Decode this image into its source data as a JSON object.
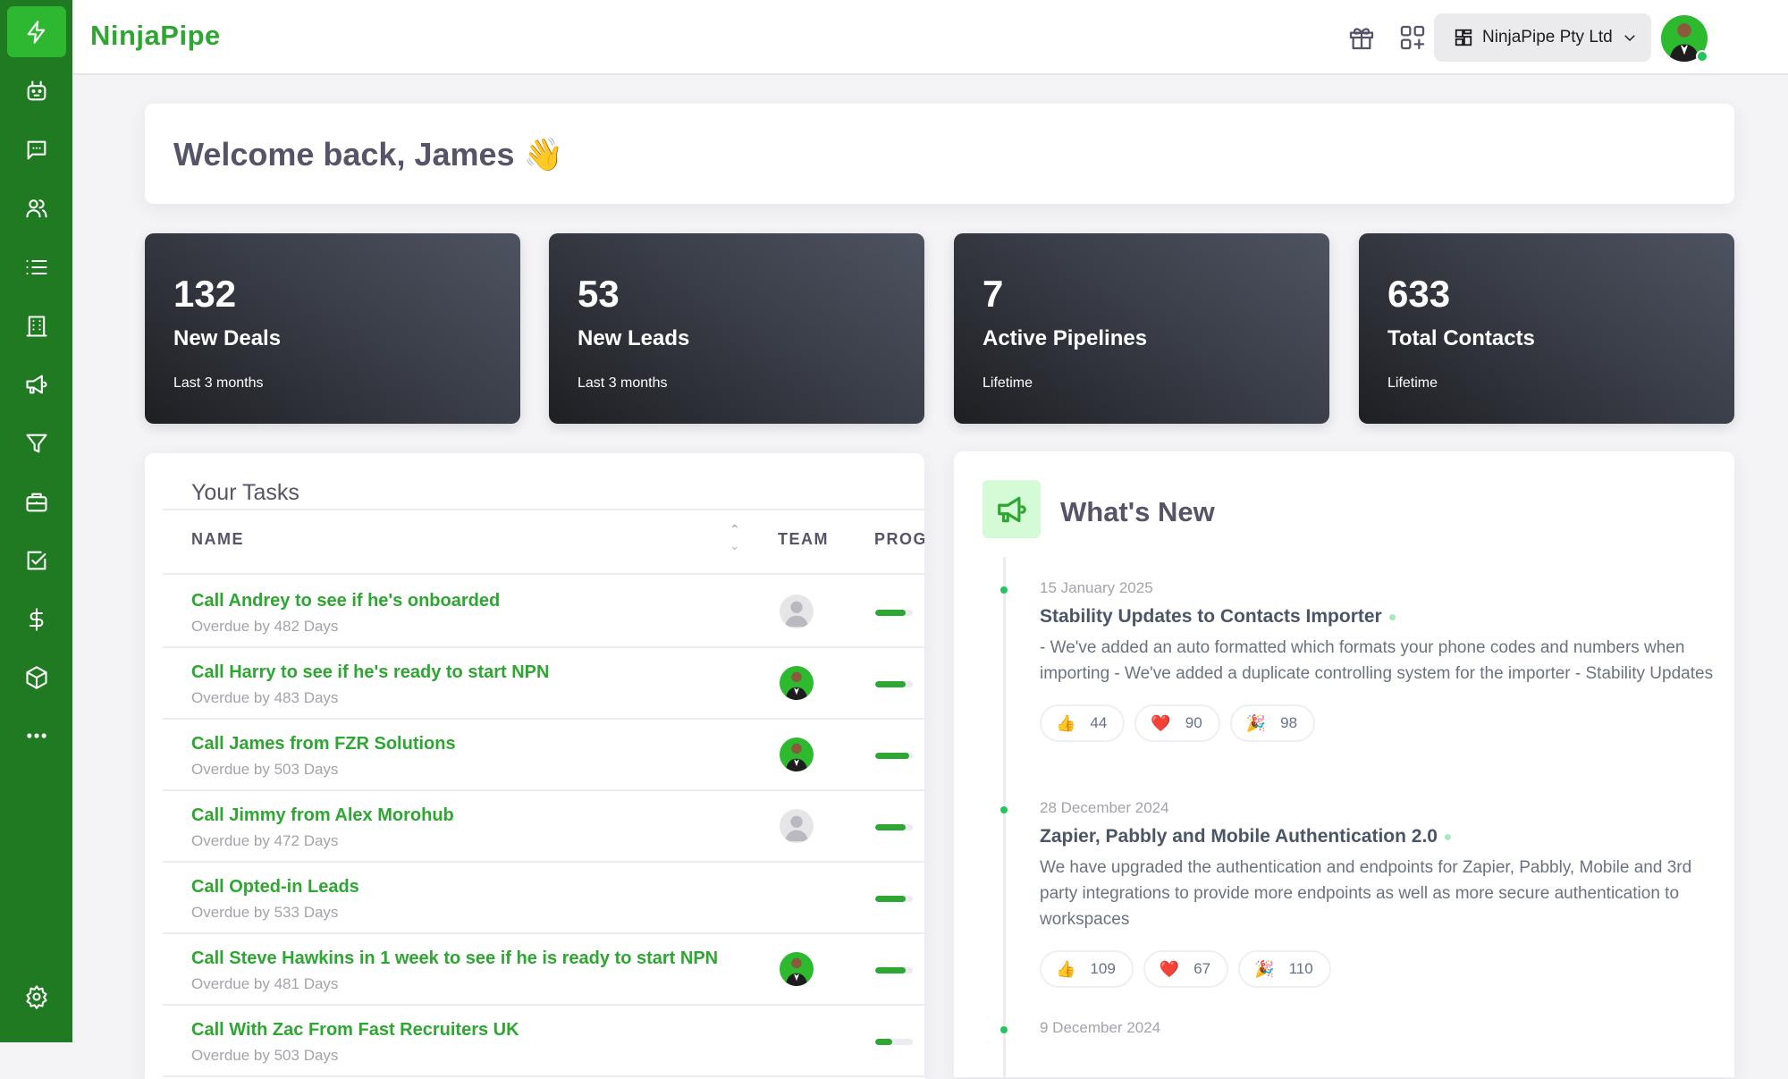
{
  "app": {
    "logo": "NinjaPipe"
  },
  "sidebar": {
    "items": [
      {
        "name": "dashboard",
        "icon": "lightning-icon",
        "active": true
      },
      {
        "name": "ai-bot",
        "icon": "robot-icon"
      },
      {
        "name": "conversations",
        "icon": "chat-icon"
      },
      {
        "name": "contacts",
        "icon": "users-icon"
      },
      {
        "name": "lists",
        "icon": "list-icon"
      },
      {
        "name": "companies",
        "icon": "building-icon"
      },
      {
        "name": "campaigns",
        "icon": "megaphone-icon"
      },
      {
        "name": "pipelines",
        "icon": "funnel-icon"
      },
      {
        "name": "deals",
        "icon": "briefcase-icon"
      },
      {
        "name": "tasks",
        "icon": "checkbox-icon"
      },
      {
        "name": "invoices",
        "icon": "dollar-icon"
      },
      {
        "name": "products",
        "icon": "cube-icon"
      },
      {
        "name": "more",
        "icon": "ellipsis-icon"
      },
      {
        "name": "settings",
        "icon": "gear-icon"
      }
    ]
  },
  "topbar": {
    "workspace_label": "NinjaPipe Pty Ltd",
    "icons": [
      "gift-icon",
      "add-app-icon",
      "bell-icon"
    ],
    "online_color": "#22c55e"
  },
  "welcome": {
    "text": "Welcome back, James",
    "emoji": "👋"
  },
  "stats": [
    {
      "value": "132",
      "label": "New Deals",
      "period": "Last 3 months"
    },
    {
      "value": "53",
      "label": "New Leads",
      "period": "Last 3 months"
    },
    {
      "value": "7",
      "label": "Active Pipelines",
      "period": "Lifetime"
    },
    {
      "value": "633",
      "label": "Total Contacts",
      "period": "Lifetime"
    }
  ],
  "tasks": {
    "title": "Your Tasks",
    "columns": {
      "name": "NAME",
      "team": "TEAM",
      "progress": "PROG"
    },
    "rows": [
      {
        "title": "Call Andrey to see if he's onboarded",
        "overdue": "Overdue by 482 Days",
        "team": "placeholder",
        "progress": 0.8
      },
      {
        "title": "Call Harry to see if he's ready to start NPN",
        "overdue": "Overdue by 483 Days",
        "team": "photo",
        "progress": 0.8
      },
      {
        "title": "Call James from FZR Solutions",
        "overdue": "Overdue by 503 Days",
        "team": "photo",
        "progress": 0.9
      },
      {
        "title": "Call Jimmy from Alex Morohub",
        "overdue": "Overdue by 472 Days",
        "team": "placeholder",
        "progress": 0.8
      },
      {
        "title": "Call Opted-in Leads",
        "overdue": "Overdue by 533 Days",
        "team": "none",
        "progress": 0.8
      },
      {
        "title": "Call Steve Hawkins in 1 week to see if he is ready to start NPN",
        "overdue": "Overdue by 481 Days",
        "team": "photo",
        "progress": 0.8
      },
      {
        "title": "Call With Zac From Fast Recruiters UK",
        "overdue": "Overdue by 503 Days",
        "team": "none",
        "progress": 0.45
      }
    ]
  },
  "whats_new": {
    "title": "What's New",
    "entries": [
      {
        "date": "15 January 2025",
        "title": "Stability Updates to Contacts Importer",
        "body": "- We've added an auto formatted which formats your phone codes and numbers when importing - We've added a duplicate controlling system for the importer - Stability Updates",
        "reactions": [
          {
            "emoji": "👍",
            "count": "44"
          },
          {
            "emoji": "❤️",
            "count": "90"
          },
          {
            "emoji": "🎉",
            "count": "98"
          }
        ]
      },
      {
        "date": "28 December 2024",
        "title": "Zapier, Pabbly and Mobile Authentication 2.0",
        "body": "We have upgraded the authentication and endpoints for Zapier, Pabbly, Mobile and 3rd party integrations to provide more endpoints as well as more secure authentication to workspaces",
        "reactions": [
          {
            "emoji": "👍",
            "count": "109"
          },
          {
            "emoji": "❤️",
            "count": "67"
          },
          {
            "emoji": "🎉",
            "count": "110"
          }
        ]
      },
      {
        "date": "9 December 2024"
      }
    ]
  }
}
